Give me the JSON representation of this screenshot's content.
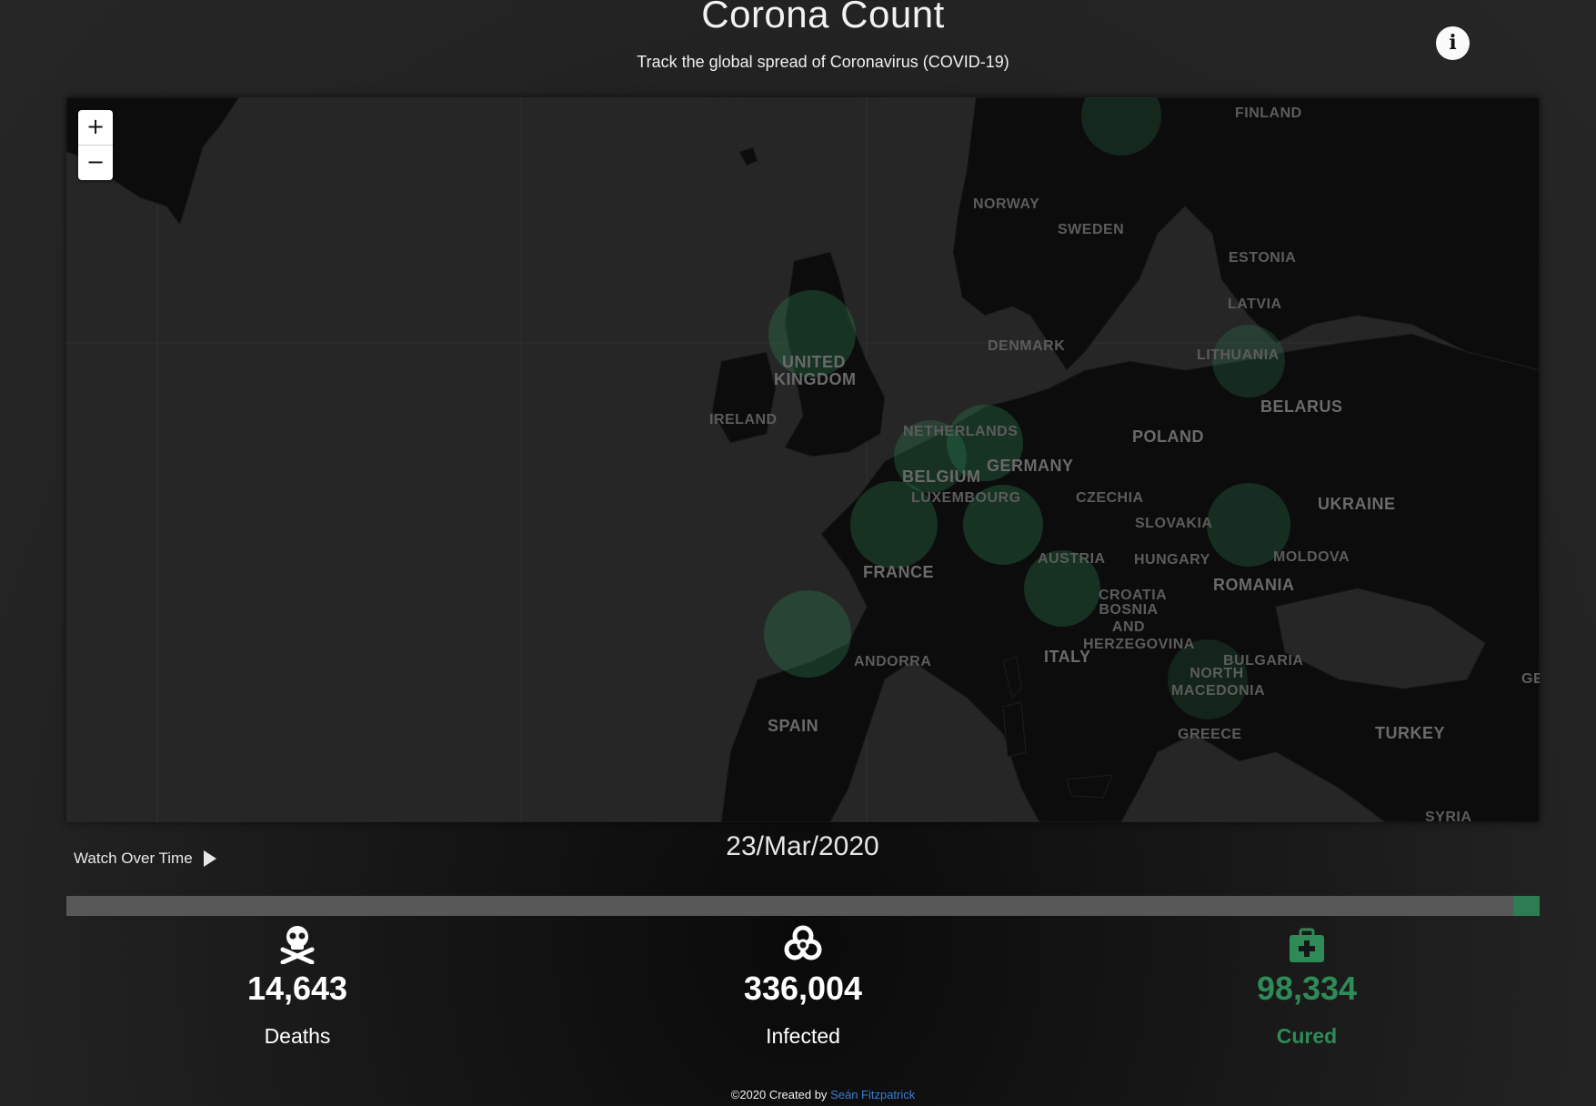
{
  "header": {
    "title": "Corona Count",
    "subtitle": "Track the global spread of Coronavirus (COVID-19)",
    "info_icon": "info-icon"
  },
  "map": {
    "zoom_in": "+",
    "zoom_out": "−",
    "countries": [
      "FINLAND",
      "NORWAY",
      "SWEDEN",
      "ESTONIA",
      "LATVIA",
      "LITHUANIA",
      "DENMARK",
      "UNITED KINGDOM",
      "IRELAND",
      "BELARUS",
      "NETHERLANDS",
      "POLAND",
      "BELGIUM",
      "GERMANY",
      "LUXEMBOURG",
      "CZECHIA",
      "UKRAINE",
      "SLOVAKIA",
      "FRANCE",
      "AUSTRIA",
      "HUNGARY",
      "MOLDOVA",
      "ROMANIA",
      "CROATIA",
      "BOSNIA AND HERZEGOVINA",
      "ITALY",
      "BULGARIA",
      "ANDORRA",
      "NORTH MACEDONIA",
      "SPAIN",
      "GREECE",
      "TURKEY",
      "SYRIA",
      "GE"
    ],
    "hotspot_color": "#2e7d52"
  },
  "controls": {
    "watch_label": "Watch Over Time",
    "play_icon": "play-icon"
  },
  "timeline": {
    "date": "23/Mar/2020",
    "progress_fraction": 0.982
  },
  "stats": {
    "deaths": {
      "value": "14,643",
      "label": "Deaths",
      "icon": "skull-crossbones-icon"
    },
    "infected": {
      "value": "336,004",
      "label": "Infected",
      "icon": "biohazard-icon"
    },
    "cured": {
      "value": "98,334",
      "label": "Cured",
      "icon": "medkit-icon",
      "color": "#2e8b57"
    }
  },
  "footer": {
    "text": "©2020 Created by",
    "author": "Seán Fitzpatrick"
  }
}
